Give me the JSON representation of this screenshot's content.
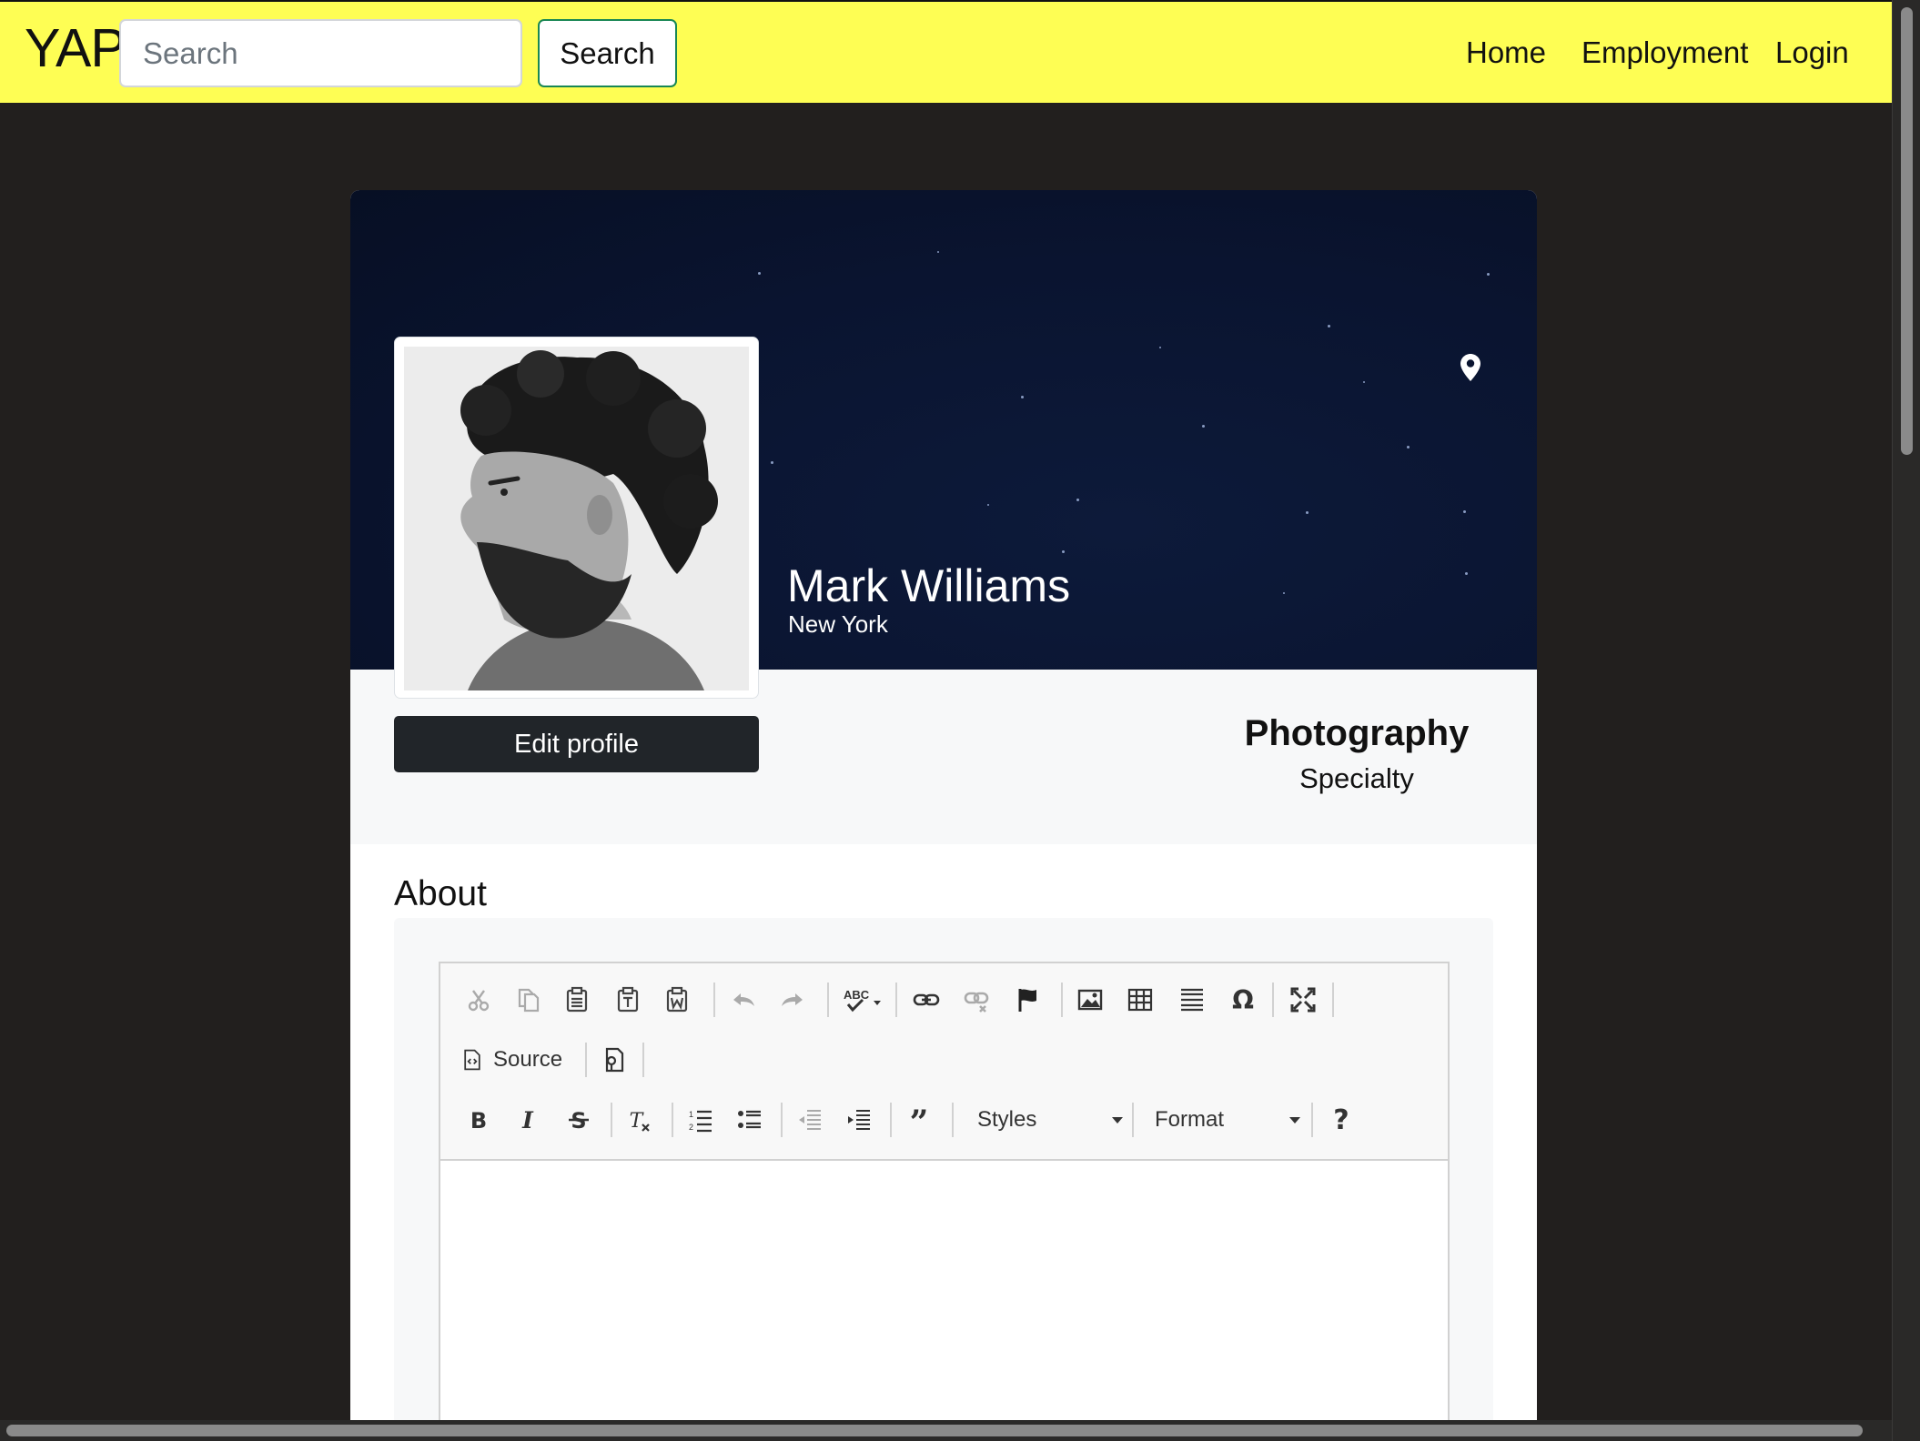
{
  "navbar": {
    "brand": "YAP",
    "search_placeholder": "Search",
    "search_button": "Search",
    "links": [
      "Home",
      "Employment",
      "Login"
    ],
    "background_color": "#fefe54"
  },
  "profile": {
    "name": "Mark Williams",
    "city": "New York",
    "edit_button": "Edit profile",
    "specialty_value": "Photography",
    "specialty_label": "Specialty",
    "location_icon": "map-pin-icon",
    "avatar_description_icon": "avatar-photo"
  },
  "about": {
    "title": "About",
    "editor": {
      "source_label": "Source",
      "styles_label": "Styles",
      "format_label": "Format",
      "help_label": "?",
      "content": ""
    }
  }
}
